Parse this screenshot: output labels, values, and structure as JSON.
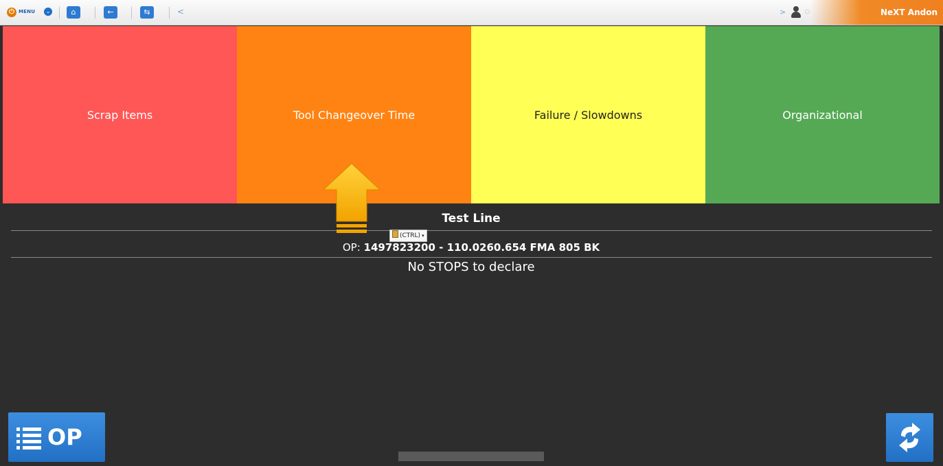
{
  "toolbar": {
    "menu_label": "MENU",
    "prev_glyph": "<",
    "next_glyph": ">",
    "brand": "NeXT Andon",
    "icons": [
      "power-icon",
      "menu-chevron-icon",
      "home-icon",
      "back-arrow-icon",
      "swap-icon",
      "user-icon"
    ]
  },
  "categories": [
    {
      "label": "Scrap Items",
      "color": "#ff5656"
    },
    {
      "label": "Tool Changeover Time",
      "color": "#ff8312"
    },
    {
      "label": "Failure / Slowdowns",
      "color": "#ffff55"
    },
    {
      "label": "Organizational",
      "color": "#55a955"
    }
  ],
  "main": {
    "line_title": "Test Line",
    "op_prefix": "OP:",
    "op_value": "1497823200 - 110.0260.654 FMA 805 BK",
    "status": "No STOPS to declare"
  },
  "paste_popup": {
    "label": "(CTRL)"
  },
  "buttons": {
    "op_label": "OP"
  },
  "colors": {
    "accent_blue": "#2e7bd1",
    "brand_orange": "#f08a26",
    "background": "#2d2d2d"
  }
}
